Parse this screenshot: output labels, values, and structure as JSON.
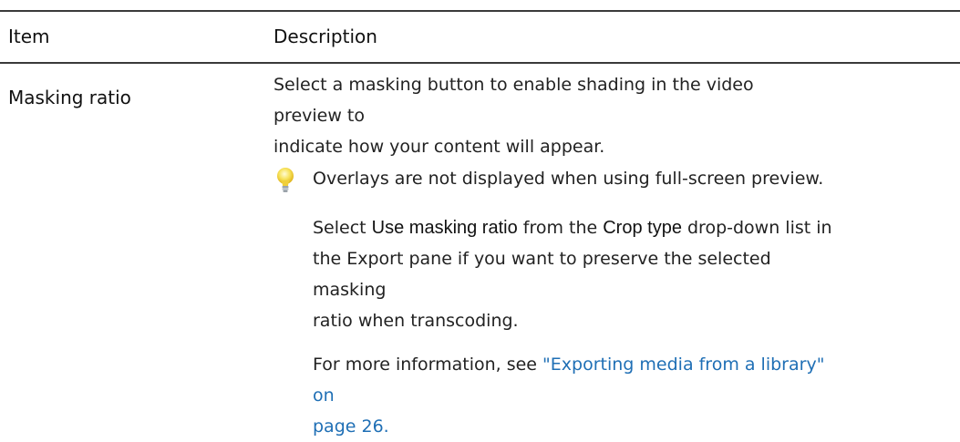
{
  "table": {
    "headers": {
      "item": "Item",
      "description": "Description"
    },
    "rows": [
      {
        "item": "Masking ratio",
        "intro_line1": "Select a masking button to enable shading in the video preview to",
        "intro_line2": "indicate how your content will appear.",
        "tip": {
          "icon": "lightbulb-icon",
          "text": "Overlays are not displayed when using full-screen preview."
        },
        "crop": {
          "part1": "Select ",
          "term1": "Use masking ratio",
          "part2": " from the ",
          "term2": "Crop type",
          "part3": " drop-down list in",
          "line2": "the Export pane if you want to preserve the selected masking",
          "line3": "ratio when transcoding."
        },
        "more": {
          "prefix": "For more information, see ",
          "link_line1": "\"Exporting media from a library\" on",
          "link_line2": "page 26."
        }
      }
    ]
  },
  "colors": {
    "link": "#1f6fb5",
    "rule": "#3a3a3a",
    "bulb": "#f2d43a"
  }
}
